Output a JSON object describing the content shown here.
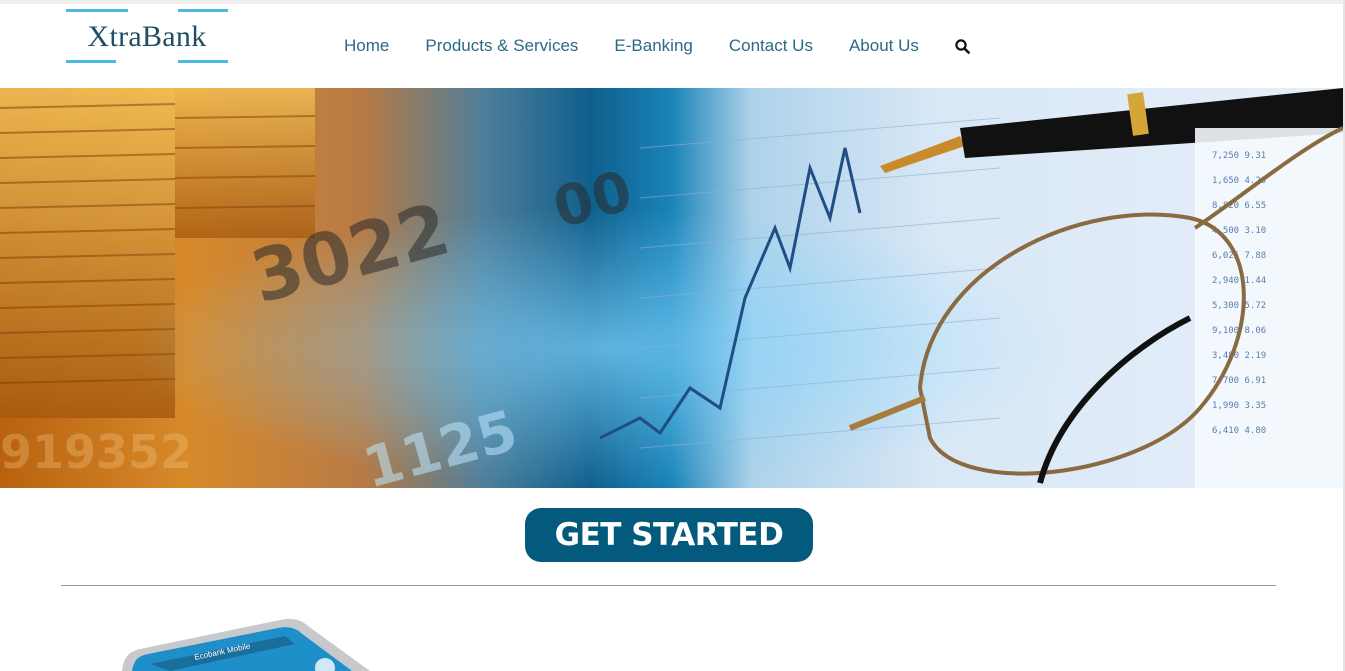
{
  "brand": {
    "name": "XtraBank",
    "accent": "#4db8dd",
    "text_color": "#1e4f63"
  },
  "nav": {
    "items": [
      {
        "label": "Home"
      },
      {
        "label": "Products & Services"
      },
      {
        "label": "E-Banking"
      },
      {
        "label": "Contact Us"
      },
      {
        "label": "About Us"
      }
    ],
    "search_icon": "search-icon",
    "link_color": "#2b6a86"
  },
  "hero": {
    "image": "finance-banner"
  },
  "cta": {
    "label": "GET STARTED",
    "color": "#035a7d"
  },
  "promo": {
    "image": "mobile-app-phone",
    "app_title": "Ecobank Mobile"
  }
}
